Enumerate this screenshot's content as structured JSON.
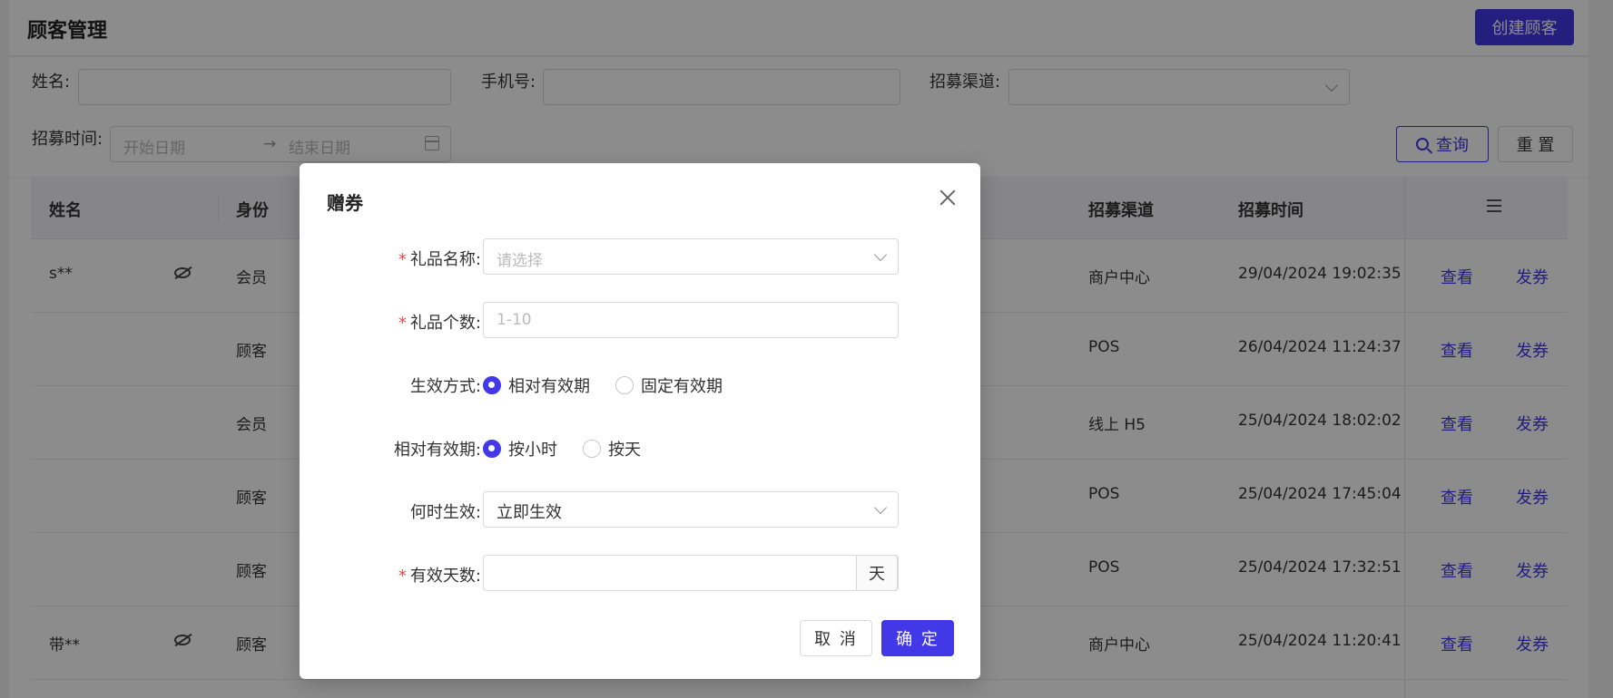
{
  "header": {
    "title": "顾客管理",
    "create_label": "创建顾客"
  },
  "filters": {
    "name_label": "姓名:",
    "phone_label": "手机号:",
    "channel_label": "招募渠道:",
    "time_label": "招募时间:",
    "start_placeholder": "开始日期",
    "end_placeholder": "结束日期",
    "arrow": "→",
    "query_label": "查询",
    "reset_label": "重 置"
  },
  "table": {
    "columns": [
      "姓名",
      "身份",
      "招募渠道",
      "招募时间"
    ],
    "view_label": "查看",
    "issue_label": "发券",
    "rows": [
      {
        "name": "s**",
        "masked": true,
        "identity": "会员",
        "channel": "商户中心",
        "time": "29/04/2024 19:02:35"
      },
      {
        "name": "",
        "masked": false,
        "identity": "顾客",
        "channel": "POS",
        "time": "26/04/2024 11:24:37"
      },
      {
        "name": "",
        "masked": false,
        "identity": "会员",
        "channel": "线上 H5",
        "time": "25/04/2024 18:02:02"
      },
      {
        "name": "",
        "masked": false,
        "identity": "顾客",
        "channel": "POS",
        "time": "25/04/2024 17:45:04"
      },
      {
        "name": "",
        "masked": false,
        "identity": "顾客",
        "channel": "POS",
        "time": "25/04/2024 17:32:51"
      },
      {
        "name": "带**",
        "masked": true,
        "identity": "顾客",
        "channel": "商户中心",
        "time": "25/04/2024 11:20:41"
      }
    ]
  },
  "modal": {
    "title": "赠券",
    "gift_name_label": "礼品名称:",
    "gift_name_placeholder": "请选择",
    "gift_count_label": "礼品个数:",
    "gift_count_placeholder": "1-10",
    "effect_mode_label": "生效方式:",
    "effect_mode_options": [
      "相对有效期",
      "固定有效期"
    ],
    "effect_mode_selected": 0,
    "relative_label": "相对有效期:",
    "relative_options": [
      "按小时",
      "按天"
    ],
    "relative_selected": 0,
    "when_label": "何时生效:",
    "when_value": "立即生效",
    "days_label": "有效天数:",
    "days_value": "",
    "days_unit": "天",
    "required_mark": "*",
    "cancel_label": "取 消",
    "ok_label": "确 定"
  },
  "colors": {
    "accent": "#4338e8",
    "required": "#f04545"
  }
}
